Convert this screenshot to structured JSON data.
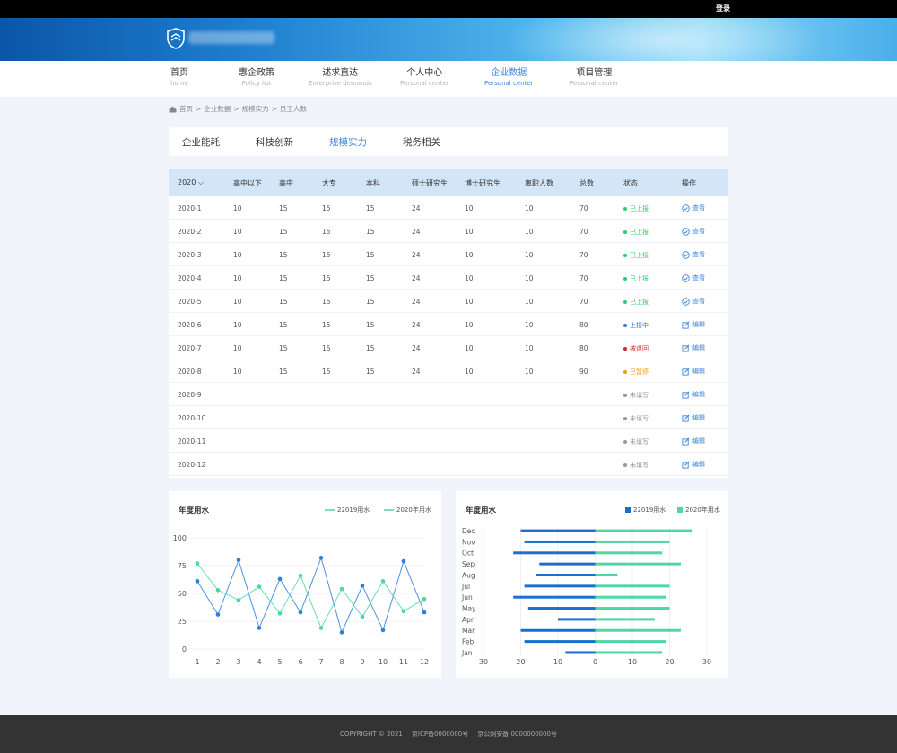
{
  "header": {
    "login_label": "登录"
  },
  "nav": [
    {
      "zh": "首页",
      "en": "home",
      "active": false
    },
    {
      "zh": "惠企政策",
      "en": "Policy list",
      "active": false
    },
    {
      "zh": "述求直达",
      "en": "Enterprise demands",
      "active": false
    },
    {
      "zh": "个人中心",
      "en": "Personal center",
      "active": false
    },
    {
      "zh": "企业数据",
      "en": "Personal center",
      "active": true
    },
    {
      "zh": "项目管理",
      "en": "Personal center",
      "active": false
    }
  ],
  "breadcrumb": [
    "首页",
    "企业数据",
    "规模实力",
    "员工人数"
  ],
  "tabs": [
    {
      "label": "企业能耗",
      "active": false
    },
    {
      "label": "科技创新",
      "active": false
    },
    {
      "label": "规模实力",
      "active": true
    },
    {
      "label": "税务相关",
      "active": false
    }
  ],
  "table": {
    "year": "2020",
    "headers": [
      "高中以下",
      "高中",
      "大专",
      "本科",
      "硕士研究生",
      "博士研究生",
      "离职人数",
      "总数",
      "状态",
      "操作"
    ],
    "rows": [
      {
        "month": "2020-1",
        "vals": [
          "10",
          "15",
          "15",
          "15",
          "24",
          "10",
          "10",
          "70"
        ],
        "status": "已上报",
        "action": "查看"
      },
      {
        "month": "2020-2",
        "vals": [
          "10",
          "15",
          "15",
          "15",
          "24",
          "10",
          "10",
          "70"
        ],
        "status": "已上报",
        "action": "查看"
      },
      {
        "month": "2020-3",
        "vals": [
          "10",
          "15",
          "15",
          "15",
          "24",
          "10",
          "10",
          "70"
        ],
        "status": "已上报",
        "action": "查看"
      },
      {
        "month": "2020-4",
        "vals": [
          "10",
          "15",
          "15",
          "15",
          "24",
          "10",
          "10",
          "70"
        ],
        "status": "已上报",
        "action": "查看"
      },
      {
        "month": "2020-5",
        "vals": [
          "10",
          "15",
          "15",
          "15",
          "24",
          "10",
          "10",
          "70"
        ],
        "status": "已上报",
        "action": "查看"
      },
      {
        "month": "2020-6",
        "vals": [
          "10",
          "15",
          "15",
          "15",
          "24",
          "10",
          "10",
          "80"
        ],
        "status": "上报中",
        "action": "编辑"
      },
      {
        "month": "2020-7",
        "vals": [
          "10",
          "15",
          "15",
          "15",
          "24",
          "10",
          "10",
          "80"
        ],
        "status": "被退回",
        "action": "编辑"
      },
      {
        "month": "2020-8",
        "vals": [
          "10",
          "15",
          "15",
          "15",
          "24",
          "10",
          "10",
          "90"
        ],
        "status": "已暂停",
        "action": "编辑"
      },
      {
        "month": "2020-9",
        "vals": [
          "",
          "",
          "",
          "",
          "",
          "",
          "",
          ""
        ],
        "status": "未填写",
        "action": "编辑"
      },
      {
        "month": "2020-10",
        "vals": [
          "",
          "",
          "",
          "",
          "",
          "",
          "",
          ""
        ],
        "status": "未填写",
        "action": "编辑"
      },
      {
        "month": "2020-11",
        "vals": [
          "",
          "",
          "",
          "",
          "",
          "",
          "",
          ""
        ],
        "status": "未填写",
        "action": "编辑"
      },
      {
        "month": "2020-12",
        "vals": [
          "",
          "",
          "",
          "",
          "",
          "",
          "",
          ""
        ],
        "status": "未填写",
        "action": "编辑"
      }
    ],
    "status_colors": {
      "已上报": "#2ecc71",
      "上报中": "#2f7ed8",
      "被退回": "#d9232e",
      "已暂停": "#f39c12",
      "未填写": "#999999"
    }
  },
  "chart_data": [
    {
      "type": "line",
      "title": "年度用水",
      "x": [
        1,
        2,
        3,
        4,
        5,
        6,
        7,
        8,
        9,
        10,
        11,
        12
      ],
      "ylim": [
        0,
        100
      ],
      "yticks": [
        0,
        25,
        50,
        75,
        100
      ],
      "grid": true,
      "legend_position": "top-right",
      "series": [
        {
          "name": "22019用水",
          "color": "#2f7ed8",
          "values": [
            61,
            31,
            80,
            19,
            63,
            33,
            82,
            15,
            57,
            17,
            79,
            33
          ]
        },
        {
          "name": "2020年用水",
          "color": "#4fd6a4",
          "values": [
            77,
            53,
            44,
            56,
            32,
            66,
            19,
            54,
            29,
            61,
            34,
            45
          ]
        }
      ]
    },
    {
      "type": "bar",
      "orientation": "horizontal",
      "title": "年度用水",
      "categories": [
        "Dec",
        "Nov",
        "Oct",
        "Sep",
        "Aug",
        "Jul",
        "Jun",
        "May",
        "Apr",
        "Mar",
        "Feb",
        "Jan"
      ],
      "xticks": [
        "30",
        "20",
        "10",
        "0",
        "10",
        "20",
        "30"
      ],
      "xlim": [
        -30,
        30
      ],
      "legend_position": "top-right",
      "series": [
        {
          "name": "22019用水",
          "color": "#1a6fcf",
          "values": [
            -20,
            -19,
            -22,
            -15,
            -16,
            -19,
            -22,
            -18,
            -10,
            -20,
            -19,
            -8
          ]
        },
        {
          "name": "2020年用水",
          "color": "#4fd6a4",
          "values": [
            26,
            20,
            18,
            23,
            6,
            20,
            19,
            20,
            16,
            23,
            19,
            18
          ]
        }
      ]
    }
  ],
  "footer": {
    "copyright": "COPYRIGHT © 2021",
    "icp": "京ICP备0000000号",
    "police": "京公网安备 0000000000号"
  }
}
